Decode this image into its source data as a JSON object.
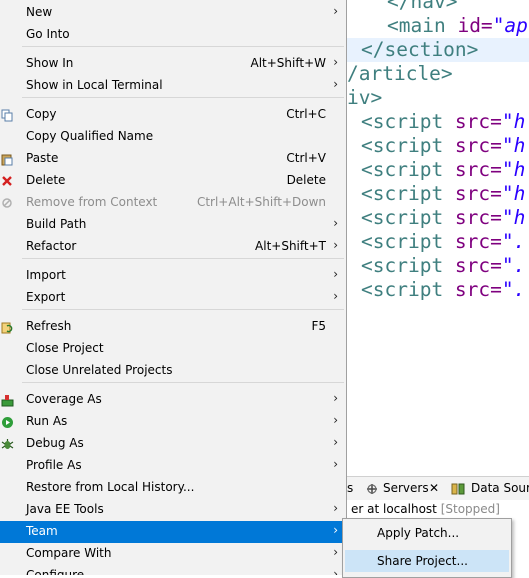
{
  "editor": {
    "lines": [
      {
        "tag": "</nav>",
        "attr": "",
        "val": ""
      },
      {
        "tag": "<main ",
        "attr": "id=",
        "val": "\"ap"
      },
      {
        "tag": "</section>",
        "attr": "",
        "val": ""
      },
      {
        "tag": "/article>",
        "attr": "",
        "val": ""
      },
      {
        "tag": "iv>",
        "attr": "",
        "val": ""
      },
      {
        "tag": "<script ",
        "attr": "src=",
        "val": "\"h"
      },
      {
        "tag": "<script ",
        "attr": "src=",
        "val": "\"h"
      },
      {
        "tag": "<script ",
        "attr": "src=",
        "val": "\"h"
      },
      {
        "tag": "<script ",
        "attr": "src=",
        "val": "\"h"
      },
      {
        "tag": "<script ",
        "attr": "src=",
        "val": "\"h"
      },
      {
        "tag": "<script ",
        "attr": "src=",
        "val": "\"."
      },
      {
        "tag": "<script ",
        "attr": "src=",
        "val": "\"."
      },
      {
        "tag": "<script ",
        "attr": "src=",
        "val": "\"."
      }
    ]
  },
  "panel": {
    "tab_frag": "s",
    "servers_tab": "Servers",
    "close_glyph": "✕",
    "datasource_tab": "Data Sourc",
    "row_text": "er at localhost",
    "row_status": "[Stopped]"
  },
  "menu": {
    "items": [
      {
        "label": "New",
        "shortcut": "",
        "submenu": true,
        "icon": ""
      },
      {
        "label": "Go Into",
        "shortcut": "",
        "submenu": false,
        "icon": ""
      },
      {
        "label": "Show In",
        "shortcut": "Alt+Shift+W",
        "submenu": true,
        "icon": ""
      },
      {
        "label": "Show in Local Terminal",
        "shortcut": "",
        "submenu": true,
        "icon": ""
      },
      {
        "label": "Copy",
        "shortcut": "Ctrl+C",
        "submenu": false,
        "icon": "copy-icon"
      },
      {
        "label": "Copy Qualified Name",
        "shortcut": "",
        "submenu": false,
        "icon": ""
      },
      {
        "label": "Paste",
        "shortcut": "Ctrl+V",
        "submenu": false,
        "icon": "paste-icon"
      },
      {
        "label": "Delete",
        "shortcut": "Delete",
        "submenu": false,
        "icon": "delete-icon"
      },
      {
        "label": "Remove from Context",
        "shortcut": "Ctrl+Alt+Shift+Down",
        "submenu": false,
        "icon": "remove-context-icon",
        "disabled": true
      },
      {
        "label": "Build Path",
        "shortcut": "",
        "submenu": true,
        "icon": ""
      },
      {
        "label": "Refactor",
        "shortcut": "Alt+Shift+T",
        "submenu": true,
        "icon": ""
      },
      {
        "label": "Import",
        "shortcut": "",
        "submenu": true,
        "icon": ""
      },
      {
        "label": "Export",
        "shortcut": "",
        "submenu": true,
        "icon": ""
      },
      {
        "label": "Refresh",
        "shortcut": "F5",
        "submenu": false,
        "icon": "refresh-icon"
      },
      {
        "label": "Close Project",
        "shortcut": "",
        "submenu": false,
        "icon": ""
      },
      {
        "label": "Close Unrelated Projects",
        "shortcut": "",
        "submenu": false,
        "icon": ""
      },
      {
        "label": "Coverage As",
        "shortcut": "",
        "submenu": true,
        "icon": "coverage-icon"
      },
      {
        "label": "Run As",
        "shortcut": "",
        "submenu": true,
        "icon": "run-icon"
      },
      {
        "label": "Debug As",
        "shortcut": "",
        "submenu": true,
        "icon": "debug-icon"
      },
      {
        "label": "Profile As",
        "shortcut": "",
        "submenu": true,
        "icon": ""
      },
      {
        "label": "Restore from Local History...",
        "shortcut": "",
        "submenu": false,
        "icon": ""
      },
      {
        "label": "Java EE Tools",
        "shortcut": "",
        "submenu": true,
        "icon": ""
      },
      {
        "label": "Team",
        "shortcut": "",
        "submenu": true,
        "icon": "",
        "active": true
      },
      {
        "label": "Compare With",
        "shortcut": "",
        "submenu": true,
        "icon": ""
      },
      {
        "label": "Configure",
        "shortcut": "",
        "submenu": true,
        "icon": ""
      }
    ]
  },
  "submenu": {
    "items": [
      {
        "label": "Apply Patch..."
      },
      {
        "label": "Share Project..."
      }
    ]
  },
  "colors": {
    "menu_bg": "#f2f2f2",
    "active_bg": "#0078d7",
    "hover_bg": "#cce4f7",
    "tag_color": "#3f7f7f",
    "attr_color": "#7f007f",
    "string_color": "#2a00ff"
  }
}
